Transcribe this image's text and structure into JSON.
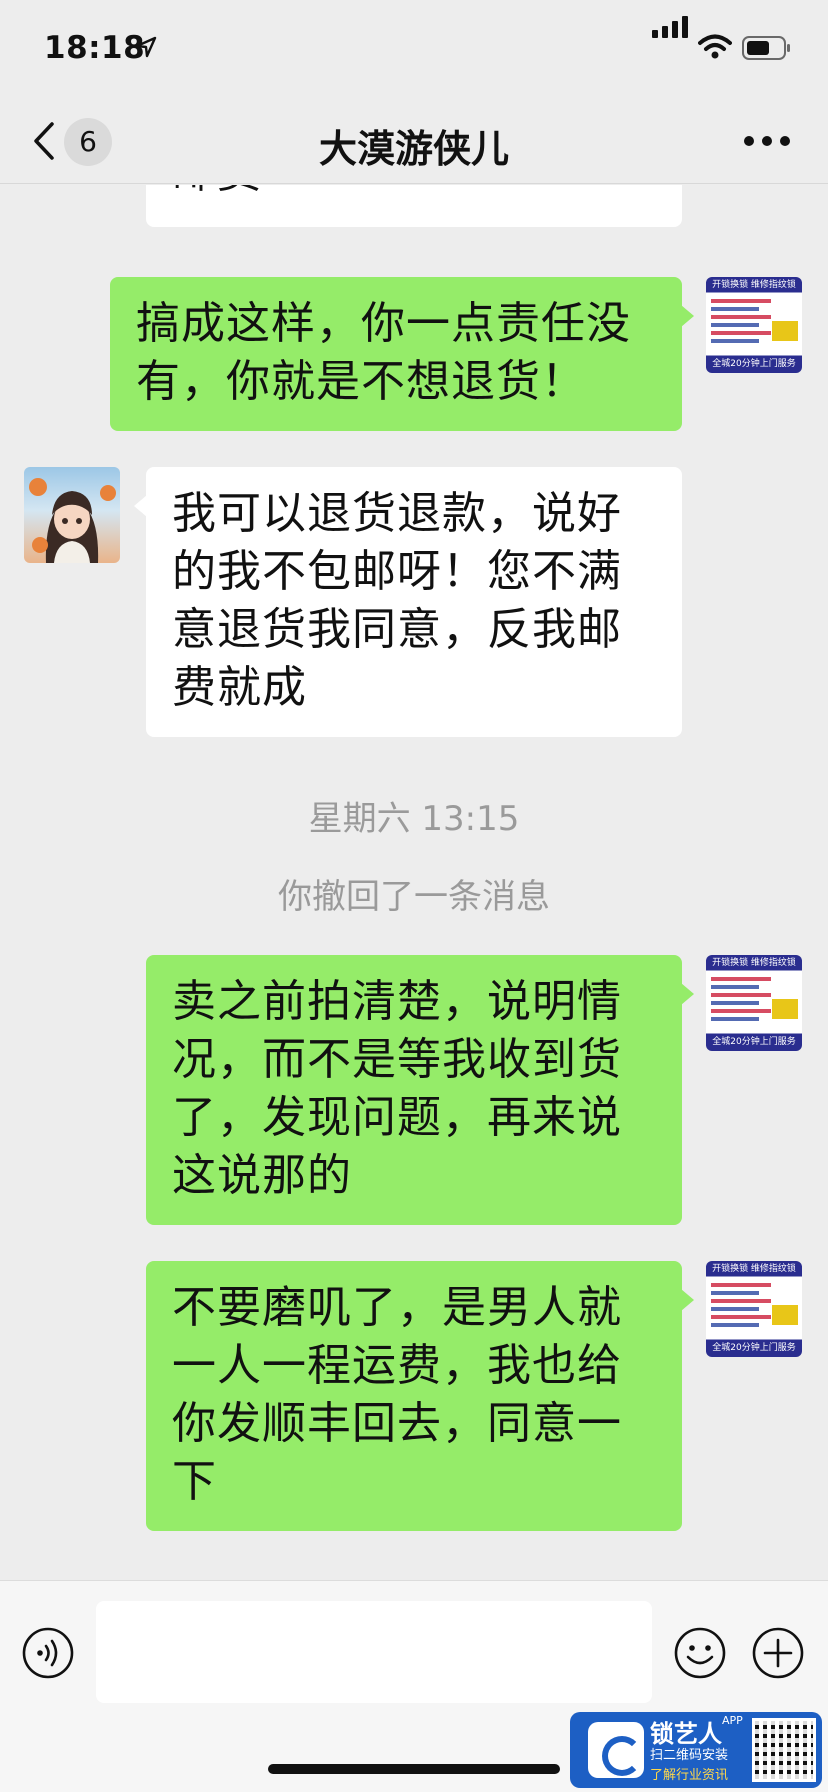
{
  "status_bar": {
    "time": "18:18"
  },
  "header": {
    "back_count": "6",
    "title": "大漠游侠儿"
  },
  "messages": [
    {
      "from": "other",
      "text": "邮费"
    },
    {
      "from": "me",
      "text": "搞成这样，你一点责任没有，你就是不想退货！"
    },
    {
      "from": "other",
      "text": "我可以退货退款，说好的我不包邮呀！您不满意退货我同意，反我邮费就成"
    },
    {
      "from": "me",
      "text": "卖之前拍清楚，说明情况，而不是等我收到货了，发现问题，再来说这说那的"
    },
    {
      "from": "me",
      "text": "不要磨叽了，是男人就一人一程运费，我也给你发顺丰回去，同意一下"
    }
  ],
  "timestamp": "星期六 13:15",
  "system_message": "你撤回了一条消息",
  "avatar_me": {
    "top_text": "开锁换锁  维修指纹锁",
    "bottom_text": "全城20分钟上门服务"
  },
  "watermark": {
    "title": "锁艺人",
    "app_tag": "APP",
    "line1": "扫二维码安装",
    "line2": "了解行业资讯"
  },
  "colors": {
    "my_bubble": "#95ec69",
    "other_bubble": "#ffffff",
    "background": "#ededed"
  }
}
